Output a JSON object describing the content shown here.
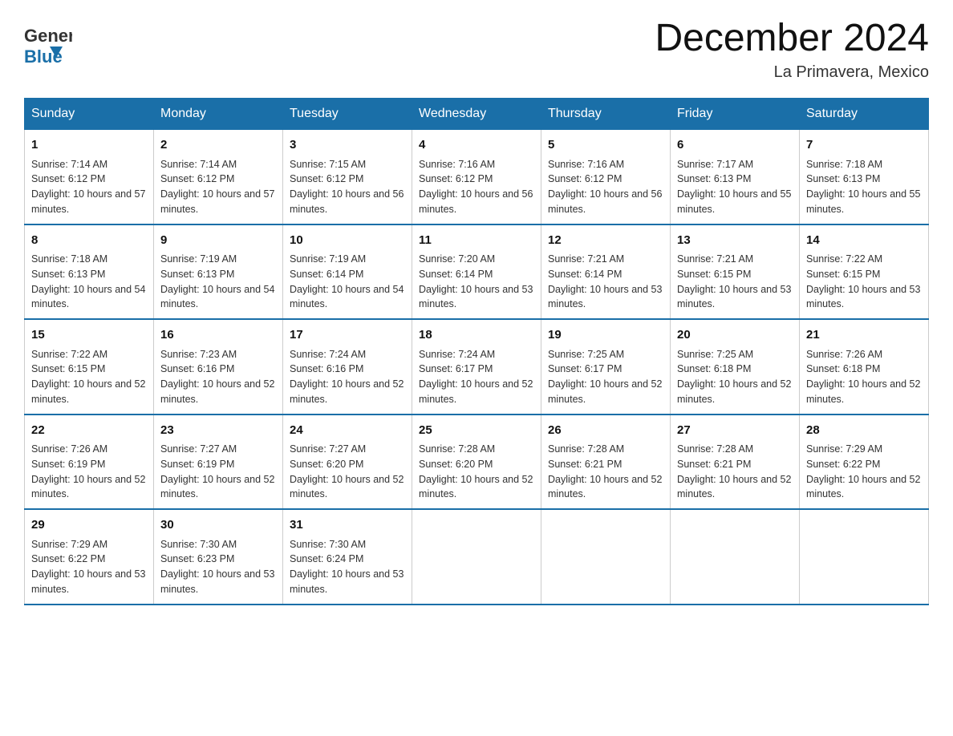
{
  "header": {
    "logo_text1": "General",
    "logo_text2": "Blue",
    "title": "December 2024",
    "subtitle": "La Primavera, Mexico"
  },
  "days_of_week": [
    "Sunday",
    "Monday",
    "Tuesday",
    "Wednesday",
    "Thursday",
    "Friday",
    "Saturday"
  ],
  "weeks": [
    [
      {
        "day": "1",
        "sunrise": "7:14 AM",
        "sunset": "6:12 PM",
        "daylight": "10 hours and 57 minutes."
      },
      {
        "day": "2",
        "sunrise": "7:14 AM",
        "sunset": "6:12 PM",
        "daylight": "10 hours and 57 minutes."
      },
      {
        "day": "3",
        "sunrise": "7:15 AM",
        "sunset": "6:12 PM",
        "daylight": "10 hours and 56 minutes."
      },
      {
        "day": "4",
        "sunrise": "7:16 AM",
        "sunset": "6:12 PM",
        "daylight": "10 hours and 56 minutes."
      },
      {
        "day": "5",
        "sunrise": "7:16 AM",
        "sunset": "6:12 PM",
        "daylight": "10 hours and 56 minutes."
      },
      {
        "day": "6",
        "sunrise": "7:17 AM",
        "sunset": "6:13 PM",
        "daylight": "10 hours and 55 minutes."
      },
      {
        "day": "7",
        "sunrise": "7:18 AM",
        "sunset": "6:13 PM",
        "daylight": "10 hours and 55 minutes."
      }
    ],
    [
      {
        "day": "8",
        "sunrise": "7:18 AM",
        "sunset": "6:13 PM",
        "daylight": "10 hours and 54 minutes."
      },
      {
        "day": "9",
        "sunrise": "7:19 AM",
        "sunset": "6:13 PM",
        "daylight": "10 hours and 54 minutes."
      },
      {
        "day": "10",
        "sunrise": "7:19 AM",
        "sunset": "6:14 PM",
        "daylight": "10 hours and 54 minutes."
      },
      {
        "day": "11",
        "sunrise": "7:20 AM",
        "sunset": "6:14 PM",
        "daylight": "10 hours and 53 minutes."
      },
      {
        "day": "12",
        "sunrise": "7:21 AM",
        "sunset": "6:14 PM",
        "daylight": "10 hours and 53 minutes."
      },
      {
        "day": "13",
        "sunrise": "7:21 AM",
        "sunset": "6:15 PM",
        "daylight": "10 hours and 53 minutes."
      },
      {
        "day": "14",
        "sunrise": "7:22 AM",
        "sunset": "6:15 PM",
        "daylight": "10 hours and 53 minutes."
      }
    ],
    [
      {
        "day": "15",
        "sunrise": "7:22 AM",
        "sunset": "6:15 PM",
        "daylight": "10 hours and 52 minutes."
      },
      {
        "day": "16",
        "sunrise": "7:23 AM",
        "sunset": "6:16 PM",
        "daylight": "10 hours and 52 minutes."
      },
      {
        "day": "17",
        "sunrise": "7:24 AM",
        "sunset": "6:16 PM",
        "daylight": "10 hours and 52 minutes."
      },
      {
        "day": "18",
        "sunrise": "7:24 AM",
        "sunset": "6:17 PM",
        "daylight": "10 hours and 52 minutes."
      },
      {
        "day": "19",
        "sunrise": "7:25 AM",
        "sunset": "6:17 PM",
        "daylight": "10 hours and 52 minutes."
      },
      {
        "day": "20",
        "sunrise": "7:25 AM",
        "sunset": "6:18 PM",
        "daylight": "10 hours and 52 minutes."
      },
      {
        "day": "21",
        "sunrise": "7:26 AM",
        "sunset": "6:18 PM",
        "daylight": "10 hours and 52 minutes."
      }
    ],
    [
      {
        "day": "22",
        "sunrise": "7:26 AM",
        "sunset": "6:19 PM",
        "daylight": "10 hours and 52 minutes."
      },
      {
        "day": "23",
        "sunrise": "7:27 AM",
        "sunset": "6:19 PM",
        "daylight": "10 hours and 52 minutes."
      },
      {
        "day": "24",
        "sunrise": "7:27 AM",
        "sunset": "6:20 PM",
        "daylight": "10 hours and 52 minutes."
      },
      {
        "day": "25",
        "sunrise": "7:28 AM",
        "sunset": "6:20 PM",
        "daylight": "10 hours and 52 minutes."
      },
      {
        "day": "26",
        "sunrise": "7:28 AM",
        "sunset": "6:21 PM",
        "daylight": "10 hours and 52 minutes."
      },
      {
        "day": "27",
        "sunrise": "7:28 AM",
        "sunset": "6:21 PM",
        "daylight": "10 hours and 52 minutes."
      },
      {
        "day": "28",
        "sunrise": "7:29 AM",
        "sunset": "6:22 PM",
        "daylight": "10 hours and 52 minutes."
      }
    ],
    [
      {
        "day": "29",
        "sunrise": "7:29 AM",
        "sunset": "6:22 PM",
        "daylight": "10 hours and 53 minutes."
      },
      {
        "day": "30",
        "sunrise": "7:30 AM",
        "sunset": "6:23 PM",
        "daylight": "10 hours and 53 minutes."
      },
      {
        "day": "31",
        "sunrise": "7:30 AM",
        "sunset": "6:24 PM",
        "daylight": "10 hours and 53 minutes."
      },
      null,
      null,
      null,
      null
    ]
  ]
}
